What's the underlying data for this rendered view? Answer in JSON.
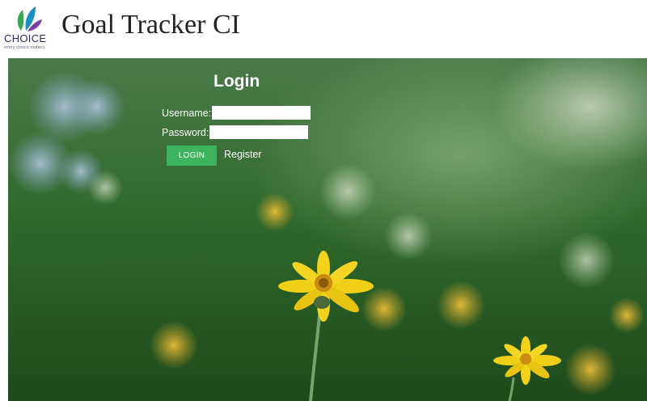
{
  "header": {
    "logo": {
      "word": "CHOICE",
      "tagline": "every choice matters",
      "colors": [
        "#3aa655",
        "#1f8fc2",
        "#7a3fa0"
      ]
    },
    "title": "Goal Tracker CI"
  },
  "login": {
    "title": "Login",
    "username_label": "Username:",
    "username_value": "",
    "password_label": "Password:",
    "password_value": "",
    "login_button": "LOGIN",
    "register_link": "Register",
    "accent_color": "#3db35d"
  },
  "background": {
    "description_icon": "flower-field-photo"
  }
}
